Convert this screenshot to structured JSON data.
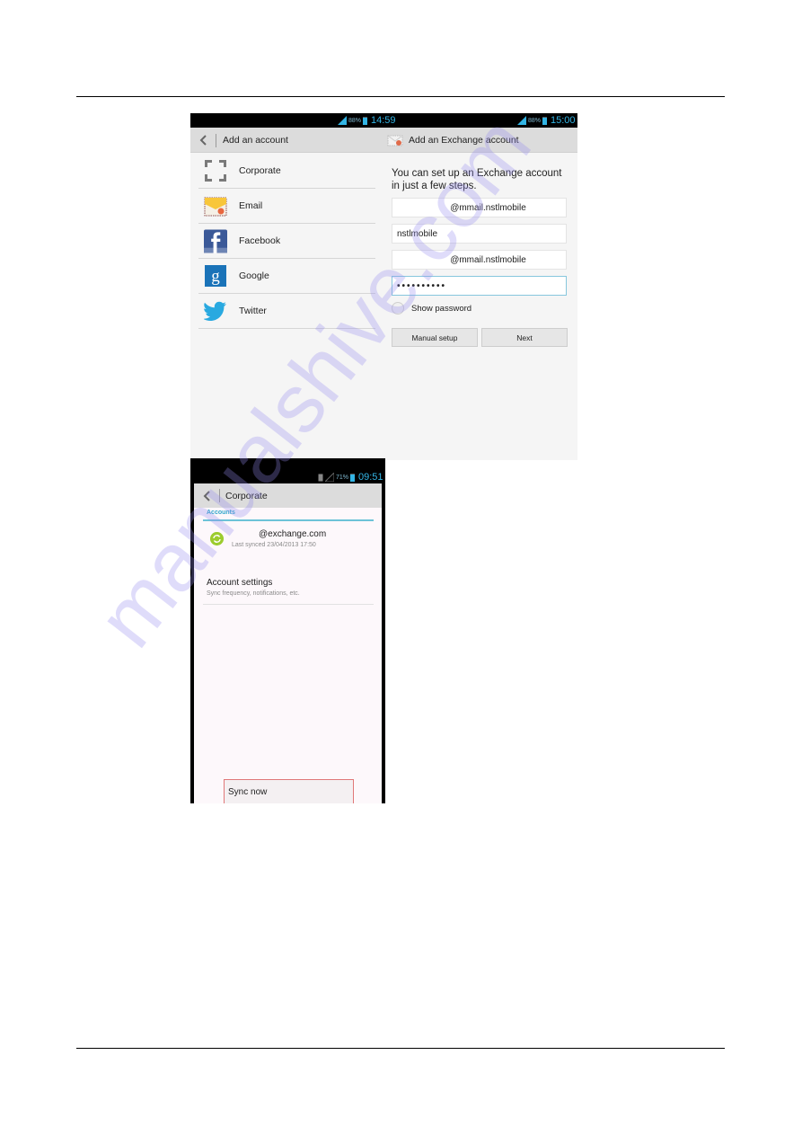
{
  "page": {
    "watermark": "manualshive.com"
  },
  "screenshot1": {
    "left_status": {
      "battery_pct": "88%",
      "time": "14:59"
    },
    "right_status": {
      "battery_pct": "88%",
      "time": "15:00"
    },
    "left_pane": {
      "title": "Add an account",
      "icons": {
        "back": "back-arrow-icon"
      },
      "accounts": [
        {
          "label": "Corporate",
          "icon": "corporate-icon"
        },
        {
          "label": "Email",
          "icon": "email-icon"
        },
        {
          "label": "Facebook",
          "icon": "facebook-icon"
        },
        {
          "label": "Google",
          "icon": "google-icon"
        },
        {
          "label": "Twitter",
          "icon": "twitter-icon"
        }
      ]
    },
    "right_pane": {
      "title": "Add an Exchange account",
      "icon": "exchange-mail-icon",
      "intro": "You can set up an Exchange account in just a few steps.",
      "fields": [
        {
          "value": "@mmail.nstlmobile"
        },
        {
          "value": "nstlmobile"
        },
        {
          "value": "@mmail.nstlmobile"
        },
        {
          "value": "••••••••••"
        }
      ],
      "show_password_label": "Show password",
      "show_password_checked": false,
      "buttons": {
        "manual_setup": "Manual setup",
        "next": "Next"
      }
    }
  },
  "screenshot2": {
    "status": {
      "battery_pct": "71%",
      "time": "09:51"
    },
    "title": "Corporate",
    "section_header": "Accounts",
    "account": {
      "email": "@exchange.com",
      "last_synced": "Last synced 23/04/2013 17:50",
      "icon": "sync-icon"
    },
    "settings": {
      "title": "Account settings",
      "subtitle": "Sync frequency, notifications, etc."
    },
    "menu_item": "Sync now"
  }
}
